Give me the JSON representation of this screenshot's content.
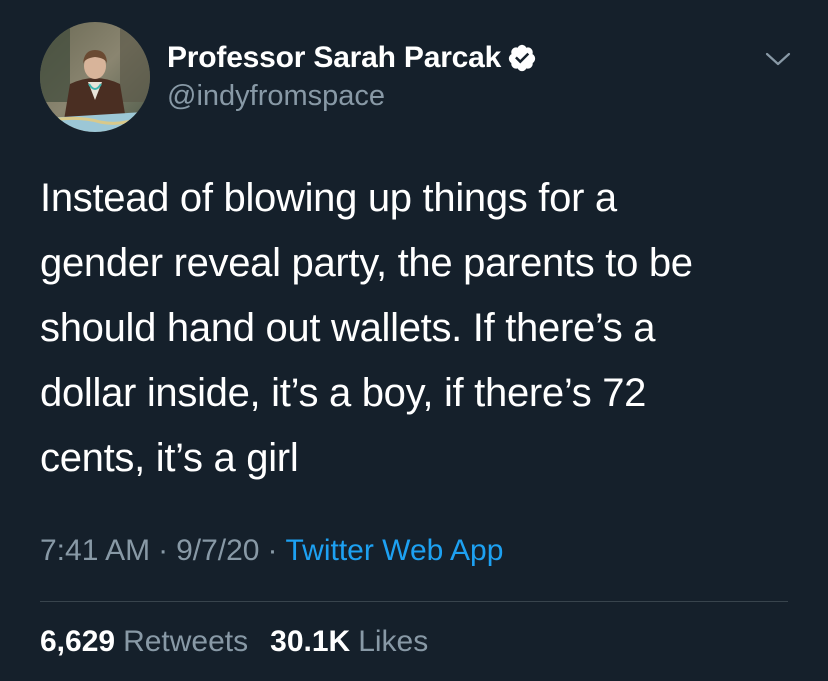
{
  "author": {
    "display_name": "Professor Sarah Parcak",
    "handle": "@indyfromspace",
    "verified": true,
    "avatar_icon": "profile-photo"
  },
  "tweet": {
    "text_lines": [
      "Instead of blowing up things for a",
      "gender reveal party, the parents to be",
      "should hand out wallets. If there’s a",
      "dollar inside, it’s a boy, if there’s 72",
      "cents, it’s a girl"
    ],
    "time": "7:41 AM",
    "separator": "·",
    "date": "9/7/20",
    "source": "Twitter Web App"
  },
  "stats": {
    "retweets_count": "6,629",
    "retweets_label": "Retweets",
    "likes_count": "30.1K",
    "likes_label": "Likes"
  },
  "colors": {
    "background": "#15202b",
    "text_primary": "#ffffff",
    "text_secondary": "#8899a6",
    "link": "#1da1f2",
    "divider": "#38444d"
  },
  "icons": {
    "verified": "verified-badge-icon",
    "menu": "chevron-down-icon"
  }
}
